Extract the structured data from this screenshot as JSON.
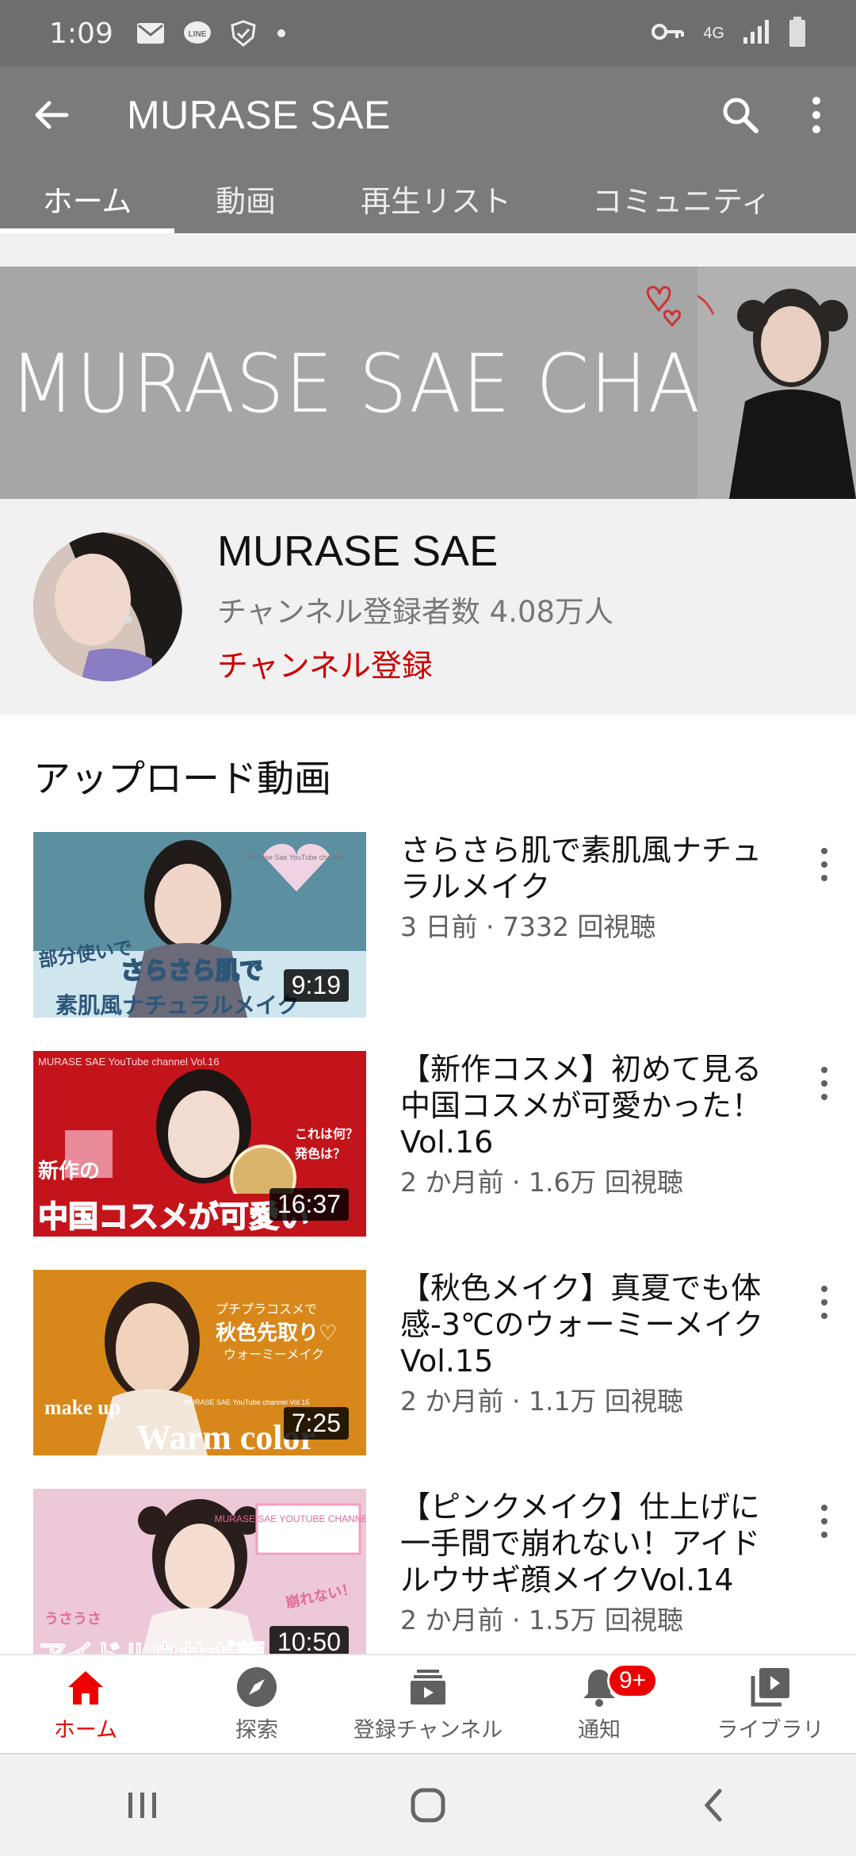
{
  "status_bar": {
    "time": "1:09",
    "network": "4G",
    "icons": [
      "mail-icon",
      "line-icon",
      "shield-check-icon",
      "dot-icon",
      "key-icon",
      "signal-icon",
      "battery-icon"
    ]
  },
  "app_bar": {
    "title": "MURASE SAE",
    "back_icon": "arrow-left-icon",
    "search_icon": "search-icon",
    "more_icon": "more-vertical-icon"
  },
  "tabs": [
    {
      "label": "ホーム",
      "active": true
    },
    {
      "label": "動画",
      "active": false
    },
    {
      "label": "再生リスト",
      "active": false
    },
    {
      "label": "コミュニティ",
      "active": false
    }
  ],
  "banner": {
    "text": "MURASE SAE CHANNEL"
  },
  "channel": {
    "name": "MURASE SAE",
    "subscribers": "チャンネル登録者数 4.08万人",
    "subscribe_label": "チャンネル登録"
  },
  "uploads": {
    "section_title": "アップロード動画",
    "videos": [
      {
        "title": "さらさら肌で素肌風ナチュラルメイク",
        "meta": "3 日前 · 7332 回視聴",
        "duration": "9:19",
        "thumb_text": [
          "部分使いで",
          "さらさら肌で",
          "素肌風ナチュラルメイク",
          "Murase Sae YouTube channel"
        ]
      },
      {
        "title": "【新作コスメ】初めて見る中国コスメが可愛かった！Vol.16",
        "meta": "2 か月前 · 1.6万 回視聴",
        "duration": "16:37",
        "thumb_text": [
          "MURASE SAE YouTube channel Vol.16",
          "新作の",
          "中国コスメが可愛い",
          "これは何？",
          "発色は？"
        ]
      },
      {
        "title": "【秋色メイク】真夏でも体感-3℃のウォーミーメイクVol.15",
        "meta": "2 か月前 · 1.1万 回視聴",
        "duration": "7:25",
        "thumb_text": [
          "プチプラコスメで",
          "秋色先取り♡",
          "ウォーミーメイク",
          "make up",
          "Warm color",
          "MURASE SAE YouTube channel Vol.15"
        ]
      },
      {
        "title": "【ピンクメイク】仕上げに一手間で崩れない！アイドルウサギ顔メイクVol.14",
        "meta": "2 か月前 · 1.5万 回視聴",
        "duration": "10:50",
        "thumb_text": [
          "MURASE SAE YOUTUBE CHANNEL Vol.14",
          "アイドルウサギ顔",
          "崩れない！",
          "うさうさ"
        ]
      }
    ]
  },
  "bottom_nav": [
    {
      "label": "ホーム",
      "icon": "home-icon",
      "active": true
    },
    {
      "label": "探索",
      "icon": "compass-icon",
      "active": false
    },
    {
      "label": "登録チャンネル",
      "icon": "subscriptions-icon",
      "active": false
    },
    {
      "label": "通知",
      "icon": "bell-icon",
      "active": false,
      "badge": "9+"
    },
    {
      "label": "ライブラリ",
      "icon": "library-icon",
      "active": false
    }
  ],
  "system_nav": [
    "recents-icon",
    "home-circle-icon",
    "back-chevron-icon"
  ],
  "colors": {
    "accent_red": "#cc0000",
    "app_bar_gray": "#7b7b7b",
    "status_bar_gray": "#6e6e6e"
  }
}
